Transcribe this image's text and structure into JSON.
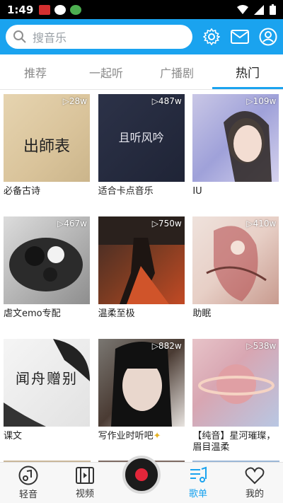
{
  "status": {
    "time": "1:49"
  },
  "search": {
    "placeholder": "搜音乐"
  },
  "tabs": [
    {
      "label": "推荐"
    },
    {
      "label": "一起听"
    },
    {
      "label": "广播剧"
    },
    {
      "label": "热门"
    }
  ],
  "playlists": [
    {
      "title": "必备古诗",
      "plays": "▷28w",
      "cover_text": "出師表"
    },
    {
      "title": "适合卡点音乐",
      "plays": "▷487w",
      "cover_text": "且听风吟"
    },
    {
      "title": "IU",
      "plays": "▷109w"
    },
    {
      "title": "虐文emo专配",
      "plays": "▷467w"
    },
    {
      "title": "温柔至极",
      "plays": "▷750w"
    },
    {
      "title": "助眠",
      "plays": "▷410w"
    },
    {
      "title": "课文",
      "plays": "",
      "cover_text": "闻舟赠别"
    },
    {
      "title": "写作业时听吧",
      "plays": "▷882w"
    },
    {
      "title": "【纯音】星河璀璨，眉目温柔",
      "plays": "▷538w"
    }
  ],
  "bottom_nav": [
    {
      "label": "轻音"
    },
    {
      "label": "视频"
    },
    {
      "label": "歌单"
    },
    {
      "label": "我的"
    }
  ],
  "colors": {
    "accent": "#1aa3ef",
    "header": "#1aa3ef"
  }
}
